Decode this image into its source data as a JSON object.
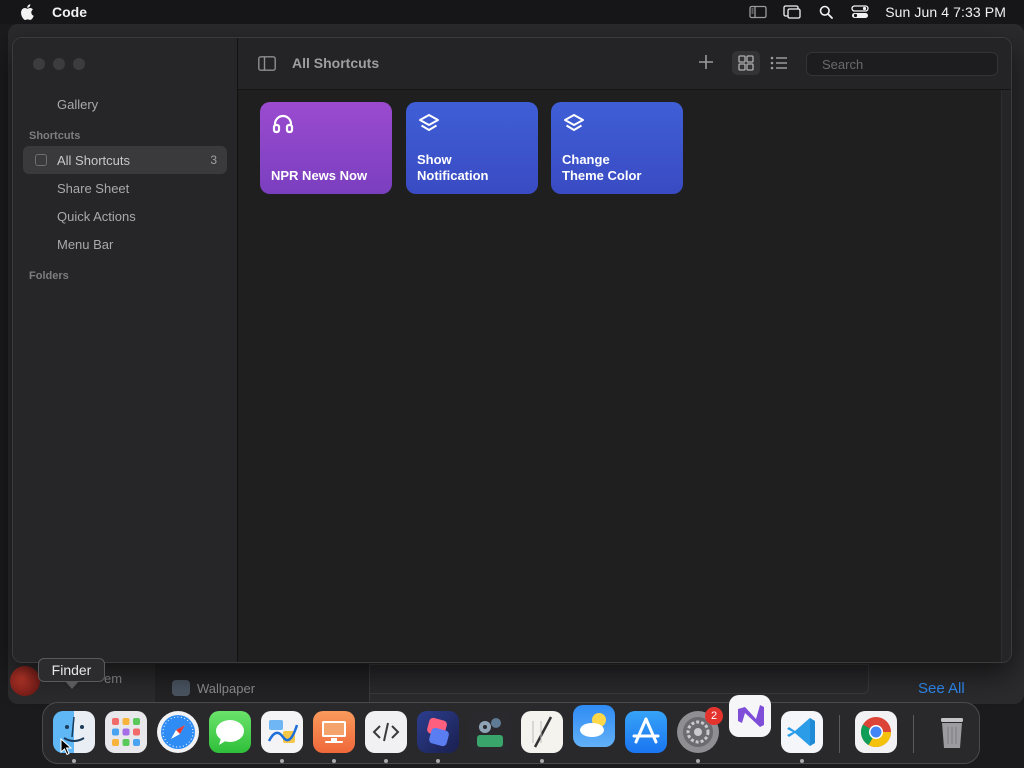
{
  "menubar": {
    "app_name": "Code",
    "clock": "Sun Jun 4  7:33 PM",
    "icons": [
      "sidebar-status-icon",
      "screen-mirroring-icon",
      "spotlight-search-icon",
      "control-center-icon"
    ]
  },
  "window": {
    "title": "All Shortcuts",
    "search_placeholder": "Search",
    "sidebar": {
      "gallery": "Gallery",
      "section_shortcuts": "Shortcuts",
      "items": [
        {
          "label": "All Shortcuts",
          "count": "3",
          "selected": true
        },
        {
          "label": "Share Sheet"
        },
        {
          "label": "Quick Actions"
        },
        {
          "label": "Menu Bar"
        }
      ],
      "section_folders": "Folders"
    },
    "tiles": [
      {
        "label": "NPR News Now",
        "icon": "headphones-icon",
        "color": "#8e45c9"
      },
      {
        "label": "Show\nNotification",
        "icon": "layers-icon",
        "color": "#3d55cf"
      },
      {
        "label": "Change\nTheme Color",
        "icon": "layers-icon",
        "color": "#3d55cf"
      }
    ]
  },
  "background": {
    "wallpaper_label": "Wallpaper",
    "system_label": "em",
    "see_all": "See All"
  },
  "dock": {
    "tooltip": "Finder",
    "apps": [
      "Finder",
      "Launchpad",
      "Safari",
      "Messages",
      "Freeform",
      "Keynote",
      "Script Editor",
      "Shortcuts",
      "Automator",
      "Script Pen",
      "Weather",
      "App Store",
      "System Settings",
      "Visual Studio",
      "Visual Studio Code",
      "Google Chrome",
      "Trash"
    ],
    "system_settings_badge": "2"
  }
}
